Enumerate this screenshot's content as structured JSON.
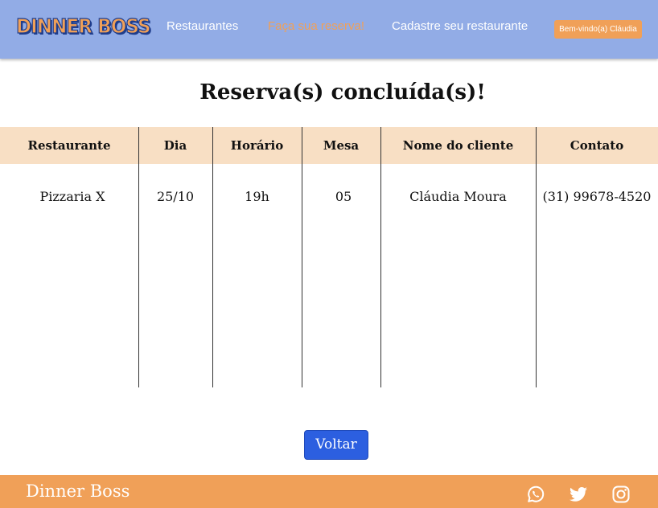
{
  "header": {
    "logo": "DINNER BOSS",
    "nav": {
      "restaurants": "Restaurantes",
      "reserve": "Faça sua reserva!",
      "register": "Cadastre seu restaurante"
    },
    "welcome": "Bem-vindo(a) Cláudia"
  },
  "main": {
    "title": "Reserva(s) concluída(s)!",
    "table": {
      "headers": [
        "Restaurante",
        "Dia",
        "Horário",
        "Mesa",
        "Nome do cliente",
        "Contato"
      ],
      "rows": [
        [
          "Pizzaria X",
          "25/10",
          "19h",
          "05",
          "Cláudia Moura",
          "(31) 99678-4520"
        ]
      ]
    },
    "back_label": "Voltar"
  },
  "footer": {
    "brand": "Dinner Boss",
    "icons": [
      "whatsapp-icon",
      "twitter-icon",
      "instagram-icon"
    ]
  },
  "colors": {
    "navbar": "#92ace6",
    "accent_orange": "#f0a058",
    "table_header": "#f8dfc4",
    "button_blue": "#2c5fe0"
  }
}
